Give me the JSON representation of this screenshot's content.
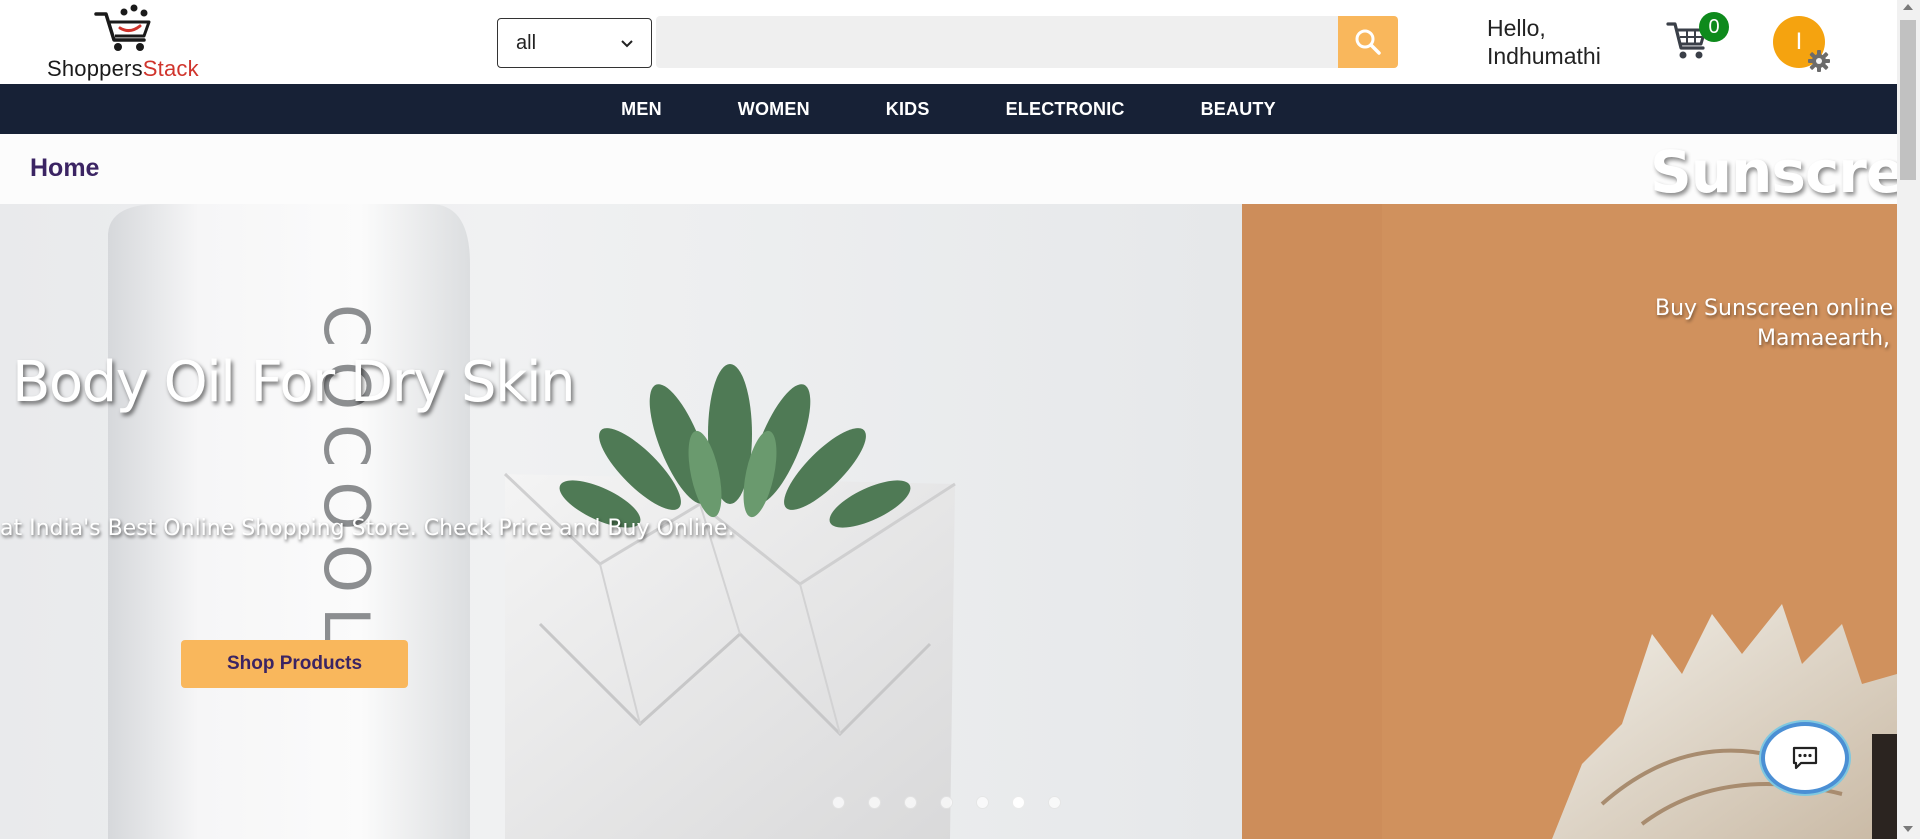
{
  "brand": {
    "logo_part1": "Shoppers",
    "logo_part2": "Stack",
    "logo_color": "#d0342c"
  },
  "search": {
    "category_selected": "all",
    "placeholder": "",
    "button_color": "#f9b75c",
    "icon": "search-icon"
  },
  "user": {
    "greeting_line1": "Hello,",
    "greeting_line2": "Indhumathi",
    "avatar_initial": "I",
    "avatar_color": "#f5a30f",
    "settings_icon": "gear-icon"
  },
  "cart": {
    "icon": "cart-icon",
    "count": "0",
    "badge_color": "#0e8a1c"
  },
  "nav": {
    "background": "#172136",
    "items": [
      {
        "label": "MEN"
      },
      {
        "label": "WOMEN"
      },
      {
        "label": "KIDS"
      },
      {
        "label": "ELECTRONIC"
      },
      {
        "label": "BEAUTY"
      }
    ]
  },
  "breadcrumb": {
    "label": "Home"
  },
  "hero": {
    "slide_left": {
      "title": "Body Oil For Dry Skin",
      "subtitle": "at India's Best Online Shopping Store. Check Price and Buy Online.",
      "button_label": "Shop Products",
      "product_text": "COCOOL"
    },
    "slide_right": {
      "title": "Sunscree",
      "subtitle_line1": "Buy Sunscreen online",
      "subtitle_line2": "Mamaearth,"
    },
    "dots_count": 7,
    "active_dot": 6
  },
  "chat": {
    "icon": "chat-icon"
  }
}
